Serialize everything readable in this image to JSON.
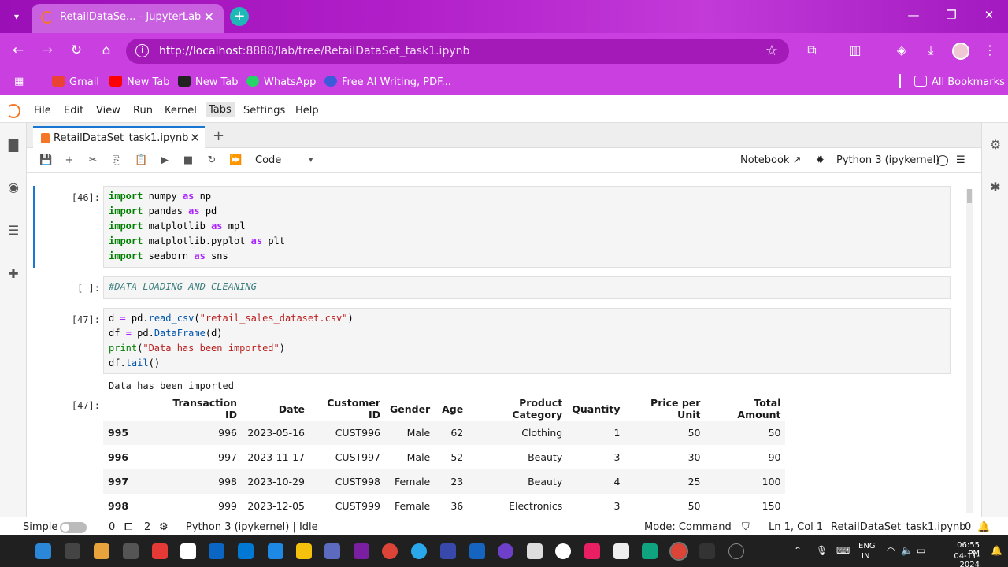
{
  "browser": {
    "tab_title": "RetailDataSe... - JupyterLab",
    "url_host": "http://localhost",
    "url_rest": ":8888/lab/tree/RetailDataSet_task1.ipynb",
    "bookmarks": [
      "Gmail",
      "New Tab",
      "New Tab",
      "WhatsApp",
      "Free AI Writing, PDF..."
    ],
    "all_bookmarks": "All Bookmarks"
  },
  "menubar": [
    "File",
    "Edit",
    "View",
    "Run",
    "Kernel",
    "Tabs",
    "Settings",
    "Help"
  ],
  "doc_tab": "RetailDataSet_task1.ipynb",
  "toolbar": {
    "cell_type": "Code",
    "notebook_label": "Notebook",
    "kernel_label": "Python 3 (ipykernel)"
  },
  "cells": {
    "c1": {
      "prompt": "[46]:",
      "lines": [
        {
          "kw": "import",
          "mod": " numpy ",
          "as": "as",
          "alias": " np"
        },
        {
          "kw": "import",
          "mod": " pandas ",
          "as": "as",
          "alias": " pd"
        },
        {
          "kw": "import",
          "mod": " matplotlib ",
          "as": "as",
          "alias": " mpl"
        },
        {
          "kw": "import",
          "mod": " matplotlib.pyplot ",
          "as": "as",
          "alias": " plt"
        },
        {
          "kw": "import",
          "mod": " seaborn ",
          "as": "as",
          "alias": " sns"
        }
      ]
    },
    "c2": {
      "prompt": "[ ]:",
      "comment": "#DATA LOADING AND CLEANING"
    },
    "c3": {
      "prompt": "[47]:",
      "l1_var": "d ",
      "l1_eq": "=",
      "l1_obj": " pd.",
      "l1_fn": "read_csv",
      "l1_po": "(",
      "l1_str": "\"retail_sales_dataset.csv\"",
      "l1_pc": ")",
      "l2_var": "df ",
      "l2_eq": "=",
      "l2_obj": " pd.",
      "l2_fn": "DataFrame",
      "l2_arg": "(d)",
      "l3_fn": "print",
      "l3_po": "(",
      "l3_str": "\"Data has been imported\"",
      "l3_pc": ")",
      "l4_obj": "df.",
      "l4_fn": "tail",
      "l4_arg": "()"
    },
    "output": {
      "prompt": "[47]:",
      "stdout": "Data has been imported",
      "columns": [
        "",
        "Transaction ID",
        "Date",
        "Customer ID",
        "Gender",
        "Age",
        "Product Category",
        "Quantity",
        "Price per Unit",
        "Total Amount"
      ],
      "rows": [
        [
          "995",
          "996",
          "2023-05-16",
          "CUST996",
          "Male",
          "62",
          "Clothing",
          "1",
          "50",
          "50"
        ],
        [
          "996",
          "997",
          "2023-11-17",
          "CUST997",
          "Male",
          "52",
          "Beauty",
          "3",
          "30",
          "90"
        ],
        [
          "997",
          "998",
          "2023-10-29",
          "CUST998",
          "Female",
          "23",
          "Beauty",
          "4",
          "25",
          "100"
        ],
        [
          "998",
          "999",
          "2023-12-05",
          "CUST999",
          "Female",
          "36",
          "Electronics",
          "3",
          "50",
          "150"
        ]
      ]
    }
  },
  "status": {
    "simple": "Simple",
    "zero": "0",
    "two": "2",
    "kernel_state": "Python 3 (ipykernel) | Idle",
    "mode": "Mode: Command",
    "position": "Ln 1, Col 1",
    "file": "RetailDataSet_task1.ipynb",
    "notif_count": "0"
  },
  "taskbar": {
    "lang": "ENG",
    "region": "IN",
    "time": "06:55 PM",
    "date": "04-11-2024"
  },
  "colors": {
    "accent": "#1976d2",
    "jupyter_orange": "#f37726",
    "browser_purple": "#c93fe0"
  }
}
